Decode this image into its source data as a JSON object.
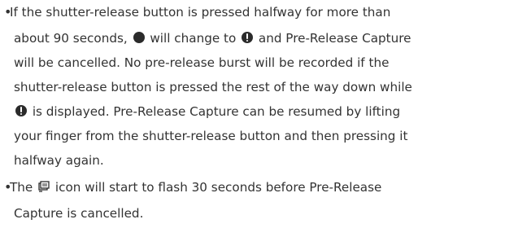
{
  "notes": [
    {
      "bullet": "•",
      "lines": [
        [
          "If the shutter-release button is pressed halfway for more than"
        ],
        [
          "about 90 seconds, ",
          {
            "icon": "filled-circle-icon"
          },
          " will change to ",
          {
            "icon": "warning-icon"
          },
          " and Pre-Release Capture"
        ],
        [
          "will be cancelled. No pre-release burst will be recorded if the"
        ],
        [
          "shutter-release button is pressed the rest of the way down while"
        ],
        [
          {
            "icon": "warning-icon"
          },
          " is displayed. Pre-Release Capture can be resumed by lifting"
        ],
        [
          "your finger from the shutter-release button and then pressing it"
        ],
        [
          "halfway again."
        ]
      ]
    },
    {
      "bullet": "•",
      "lines": [
        [
          "The ",
          {
            "icon": "pre-release-capture-icon"
          },
          " icon will start to flash 30 seconds before Pre-Release"
        ],
        [
          "Capture is cancelled."
        ]
      ]
    }
  ],
  "text": {
    "n0l0s0": "If the shutter-release button is pressed halfway for more than",
    "n0l1s0": "about 90 seconds, ",
    "n0l1s2": " will change to ",
    "n0l1s4": " and Pre-Release Capture",
    "n0l2s0": "will be cancelled. No pre-release burst will be recorded if the",
    "n0l3s0": "shutter-release button is pressed the rest of the way down while",
    "n0l4s1": " is displayed. Pre-Release Capture can be resumed by lifting",
    "n0l5s0": "your finger from the shutter-release button and then pressing it",
    "n0l6s0": "halfway again.",
    "n1l0s0": "The ",
    "n1l0s2": " icon will start to flash 30 seconds before Pre-Release",
    "n1l1s0": "Capture is cancelled."
  },
  "bullets": {
    "first": "•",
    "second": "•"
  },
  "colors": {
    "text": "#333333",
    "icon": "#2b2b2b",
    "background": "#ffffff"
  }
}
